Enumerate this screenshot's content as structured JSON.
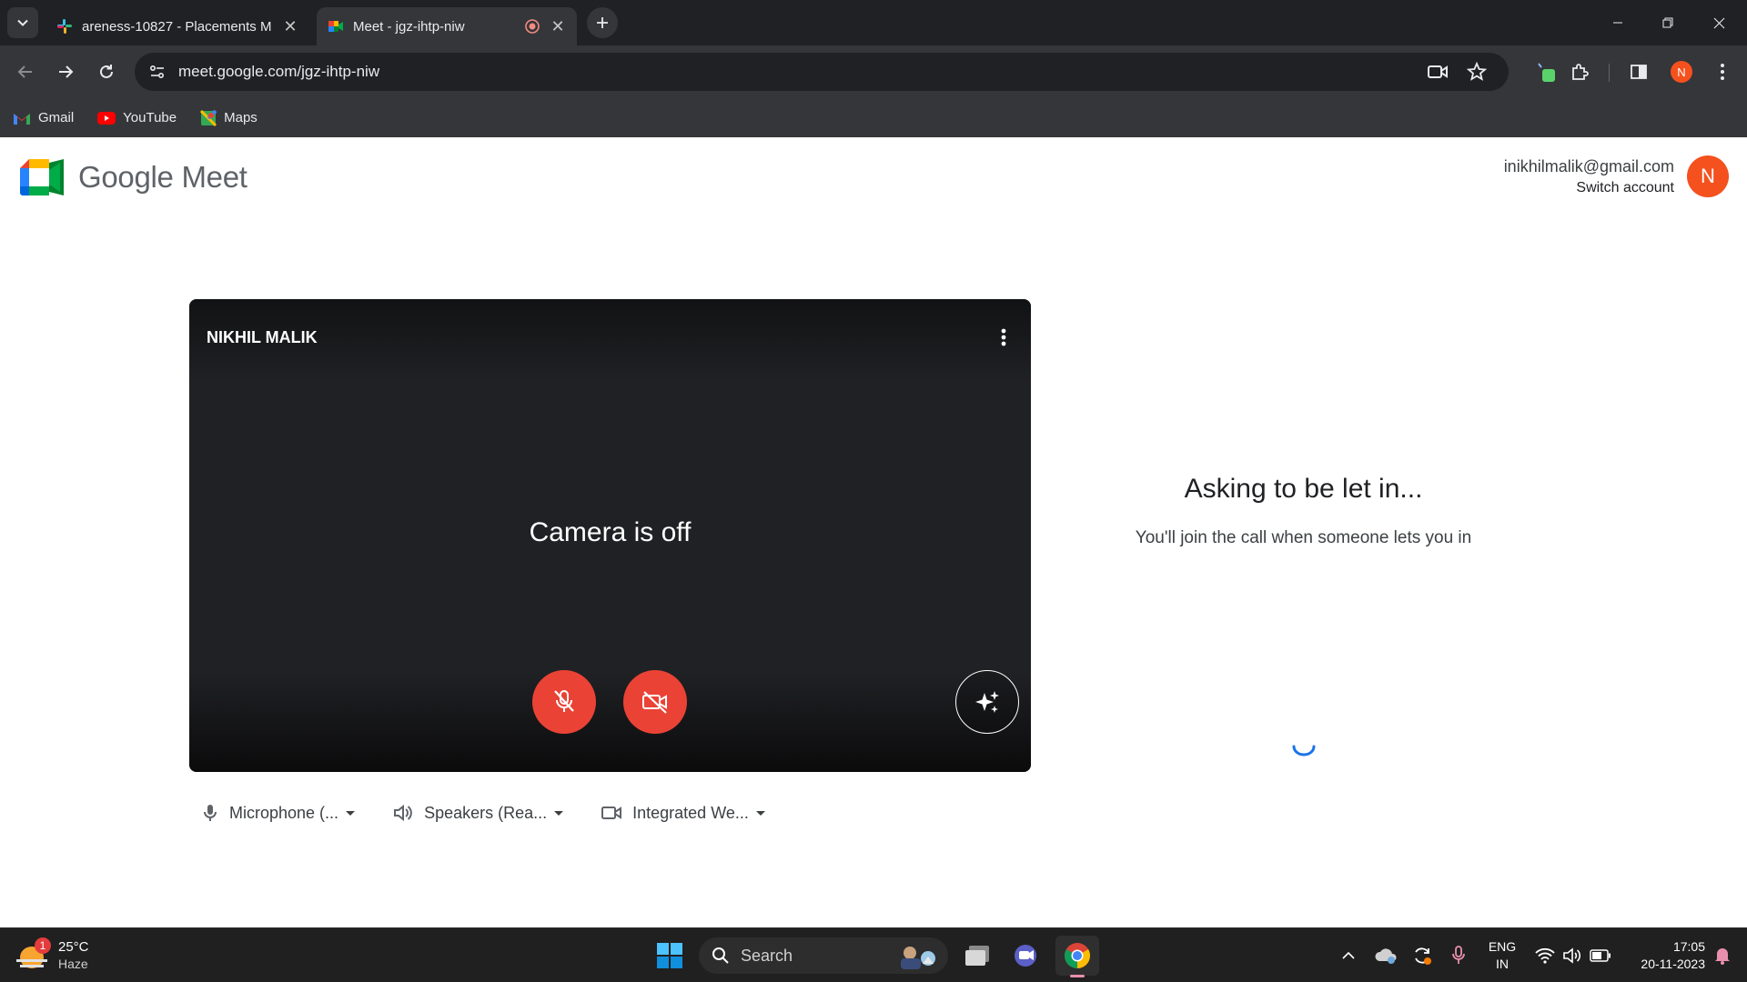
{
  "browser": {
    "tabs": [
      {
        "title": "areness-10827 - Placements M",
        "active": false
      },
      {
        "title": "Meet - jgz-ihtp-niw",
        "active": true
      }
    ],
    "url": "meet.google.com/jgz-ihtp-niw",
    "bookmarks": [
      "Gmail",
      "YouTube",
      "Maps"
    ],
    "profile_initial": "N"
  },
  "meet": {
    "logo_text": "Google Meet",
    "account_email": "inikhilmalik@gmail.com",
    "switch_account": "Switch account",
    "avatar_initial": "N",
    "preview": {
      "participant_name": "NIKHIL MALIK",
      "camera_status": "Camera is off"
    },
    "devices": {
      "microphone": "Microphone (...",
      "speakers": "Speakers (Rea...",
      "camera": "Integrated We..."
    },
    "status": {
      "heading": "Asking to be let in...",
      "message": "You'll join the call when someone lets you in"
    }
  },
  "taskbar": {
    "weather_temp": "25°C",
    "weather_desc": "Haze",
    "weather_badge": "1",
    "search_placeholder": "Search",
    "language": "ENG",
    "region": "IN",
    "time": "17:05",
    "date": "20-11-2023"
  },
  "colors": {
    "accent_red": "#ea4335",
    "avatar_orange": "#f4511e",
    "spinner_blue": "#1a73e8"
  }
}
